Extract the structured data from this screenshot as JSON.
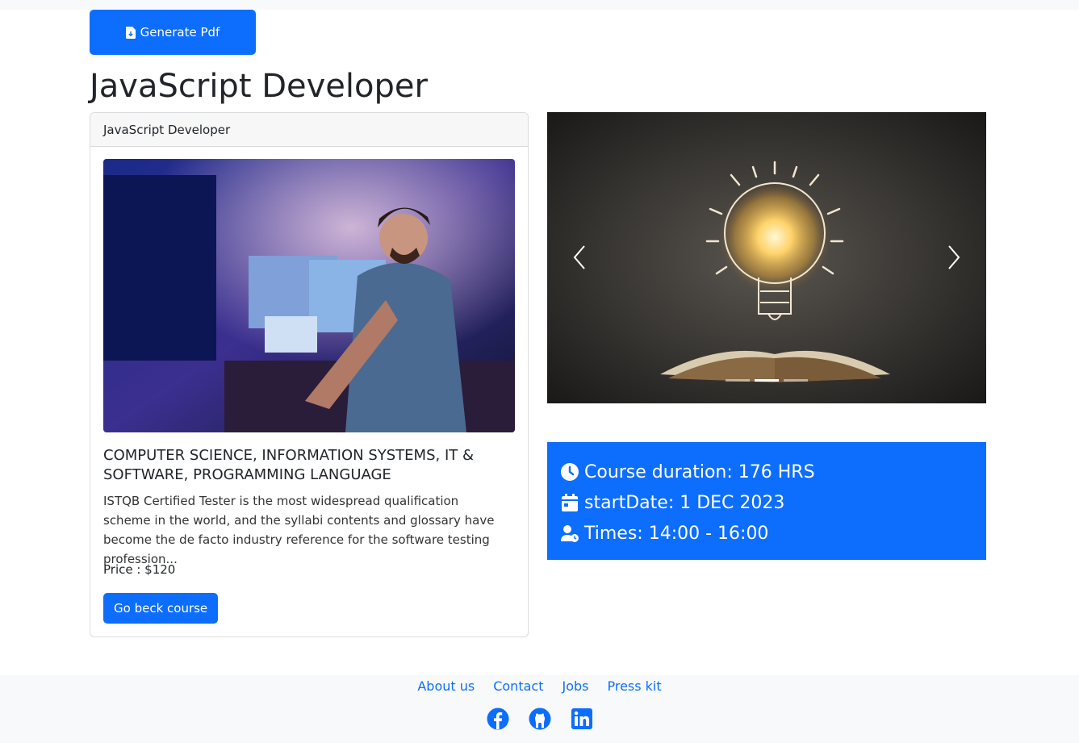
{
  "toolbar": {
    "generate_label": "Generate Pdf",
    "generate_icon": "file-download-icon"
  },
  "page": {
    "title": "JavaScript Developer"
  },
  "card": {
    "header": "JavaScript Developer",
    "image_icon": "developer-photo",
    "category": "COMPUTER SCIENCE, INFORMATION SYSTEMS, IT & SOFTWARE, PROGRAMMING LANGUAGE",
    "description": "ISTQB Certified Tester is the most widespread qualification scheme in the world, and the syllabi contents and glossary have become the de facto industry reference for the software testing profession...",
    "price": "Price : $120",
    "back_button": "Go beck course"
  },
  "carousel": {
    "image_icon": "lightbulb-book-image",
    "indicators": 3,
    "active_index": 1
  },
  "course_info": {
    "duration": "Course duration: 176 HRS",
    "start_date": "startDate: 1 DEC 2023",
    "times": "Times: 14:00 - 16:00"
  },
  "footer": {
    "links": [
      "About us",
      "Contact",
      "Jobs",
      "Press kit"
    ],
    "social": [
      "facebook-icon",
      "github-icon",
      "linkedin-icon"
    ]
  },
  "colors": {
    "primary": "#0d6efd",
    "footer_bg": "#f8f9fa"
  }
}
